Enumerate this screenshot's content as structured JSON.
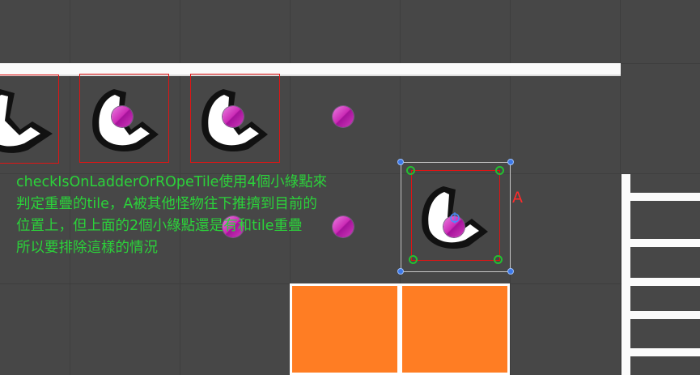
{
  "scene": {
    "annotation_lines": [
      "checkIsOnLadderOrROpeTile使用4個小綠點來",
      "判定重疊的tile，A被其他怪物往下推擠到目前的",
      "位置上，但上面的2個小綠點還是有和tile重疊",
      "所以要排除這樣的情況"
    ],
    "selected_label": "A"
  },
  "colors": {
    "background": "#474747",
    "grid": "#3e3e3e",
    "tile_white": "#fbfbfb",
    "tile_orange": "#ff7d23",
    "annotation_text": "#2bd23a",
    "label_red": "#ff2b2b",
    "collider_red": "#e01414",
    "dot_magenta": "#cc2bb6"
  },
  "icons": {
    "monster": "monster-sprite-icon",
    "dot": "magenta-dot-icon",
    "green_point": "green-check-point-icon",
    "handle": "transform-handle-icon"
  }
}
